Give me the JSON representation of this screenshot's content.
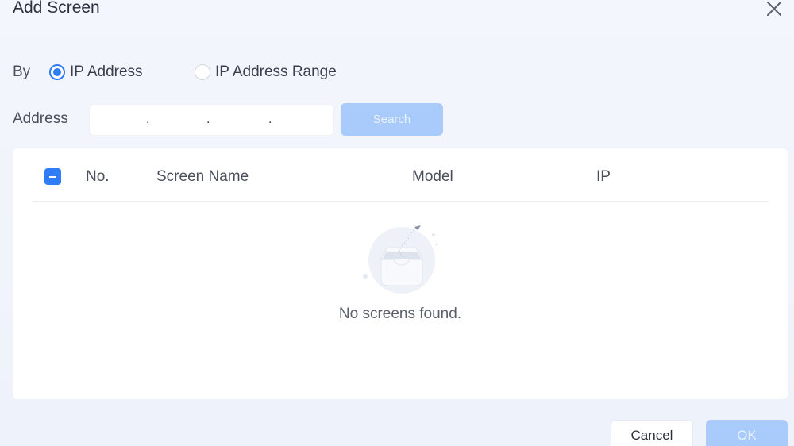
{
  "dialog": {
    "title": "Add Screen",
    "close_icon": "close-icon"
  },
  "by": {
    "label": "By",
    "options": [
      {
        "label": "IP Address",
        "selected": true
      },
      {
        "label": "IP Address Range",
        "selected": false
      }
    ]
  },
  "address": {
    "label": "Address",
    "value": "",
    "separators": [
      ".",
      ".",
      "."
    ],
    "search_label": "Search"
  },
  "table": {
    "select_all_state": "indeterminate",
    "columns": [
      "No.",
      "Screen Name",
      "Model",
      "IP"
    ],
    "rows": [],
    "empty_text": "No screens found.",
    "empty_icon": "empty-inbox-icon"
  },
  "footer": {
    "cancel_label": "Cancel",
    "ok_label": "OK"
  },
  "colors": {
    "accent": "#2f7cf6",
    "disabled_button": "#a9cbfb",
    "background": "#f3f6fc"
  }
}
